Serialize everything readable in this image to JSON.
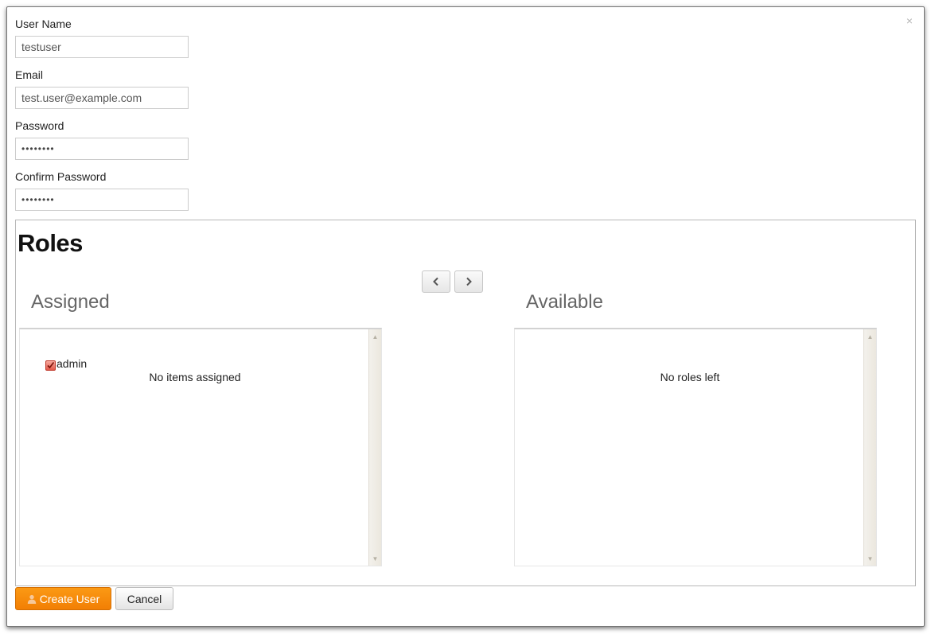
{
  "dialog": {
    "close_label": "×"
  },
  "form": {
    "username": {
      "label": "User Name",
      "value": "testuser"
    },
    "email": {
      "label": "Email",
      "value": "test.user@example.com"
    },
    "password": {
      "label": "Password",
      "value": "••••••••"
    },
    "confirm_password": {
      "label": "Confirm Password",
      "value": "••••••••"
    }
  },
  "roles": {
    "title": "Roles",
    "move_left_icon": "chevron-left-icon",
    "move_right_icon": "chevron-right-icon",
    "assigned": {
      "title": "Assigned",
      "items": [
        {
          "label": "admin",
          "checked": true
        }
      ],
      "empty_message": "No items assigned"
    },
    "available": {
      "title": "Available",
      "items": [],
      "empty_message": "No roles left"
    }
  },
  "actions": {
    "create_label": "Create User",
    "create_icon": "user-icon",
    "cancel_label": "Cancel"
  },
  "colors": {
    "primary_button": "#f7890c",
    "checkbox": "#e2584a",
    "heading_muted": "#666666"
  }
}
